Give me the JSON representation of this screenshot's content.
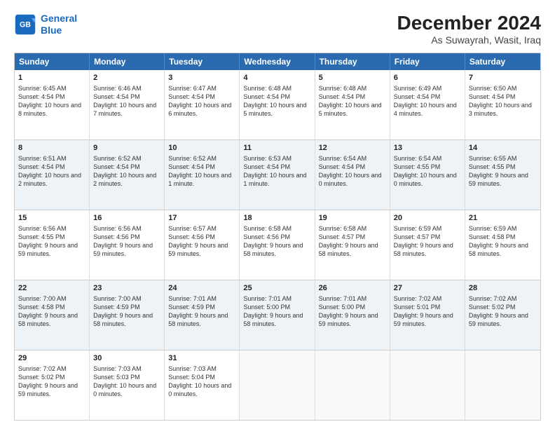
{
  "header": {
    "logo_line1": "General",
    "logo_line2": "Blue",
    "title": "December 2024",
    "subtitle": "As Suwayrah, Wasit, Iraq"
  },
  "calendar": {
    "days": [
      "Sunday",
      "Monday",
      "Tuesday",
      "Wednesday",
      "Thursday",
      "Friday",
      "Saturday"
    ],
    "rows": [
      [
        {
          "day": "1",
          "sunrise": "Sunrise: 6:45 AM",
          "sunset": "Sunset: 4:54 PM",
          "daylight": "Daylight: 10 hours and 8 minutes."
        },
        {
          "day": "2",
          "sunrise": "Sunrise: 6:46 AM",
          "sunset": "Sunset: 4:54 PM",
          "daylight": "Daylight: 10 hours and 7 minutes."
        },
        {
          "day": "3",
          "sunrise": "Sunrise: 6:47 AM",
          "sunset": "Sunset: 4:54 PM",
          "daylight": "Daylight: 10 hours and 6 minutes."
        },
        {
          "day": "4",
          "sunrise": "Sunrise: 6:48 AM",
          "sunset": "Sunset: 4:54 PM",
          "daylight": "Daylight: 10 hours and 5 minutes."
        },
        {
          "day": "5",
          "sunrise": "Sunrise: 6:48 AM",
          "sunset": "Sunset: 4:54 PM",
          "daylight": "Daylight: 10 hours and 5 minutes."
        },
        {
          "day": "6",
          "sunrise": "Sunrise: 6:49 AM",
          "sunset": "Sunset: 4:54 PM",
          "daylight": "Daylight: 10 hours and 4 minutes."
        },
        {
          "day": "7",
          "sunrise": "Sunrise: 6:50 AM",
          "sunset": "Sunset: 4:54 PM",
          "daylight": "Daylight: 10 hours and 3 minutes."
        }
      ],
      [
        {
          "day": "8",
          "sunrise": "Sunrise: 6:51 AM",
          "sunset": "Sunset: 4:54 PM",
          "daylight": "Daylight: 10 hours and 2 minutes."
        },
        {
          "day": "9",
          "sunrise": "Sunrise: 6:52 AM",
          "sunset": "Sunset: 4:54 PM",
          "daylight": "Daylight: 10 hours and 2 minutes."
        },
        {
          "day": "10",
          "sunrise": "Sunrise: 6:52 AM",
          "sunset": "Sunset: 4:54 PM",
          "daylight": "Daylight: 10 hours and 1 minute."
        },
        {
          "day": "11",
          "sunrise": "Sunrise: 6:53 AM",
          "sunset": "Sunset: 4:54 PM",
          "daylight": "Daylight: 10 hours and 1 minute."
        },
        {
          "day": "12",
          "sunrise": "Sunrise: 6:54 AM",
          "sunset": "Sunset: 4:54 PM",
          "daylight": "Daylight: 10 hours and 0 minutes."
        },
        {
          "day": "13",
          "sunrise": "Sunrise: 6:54 AM",
          "sunset": "Sunset: 4:55 PM",
          "daylight": "Daylight: 10 hours and 0 minutes."
        },
        {
          "day": "14",
          "sunrise": "Sunrise: 6:55 AM",
          "sunset": "Sunset: 4:55 PM",
          "daylight": "Daylight: 9 hours and 59 minutes."
        }
      ],
      [
        {
          "day": "15",
          "sunrise": "Sunrise: 6:56 AM",
          "sunset": "Sunset: 4:55 PM",
          "daylight": "Daylight: 9 hours and 59 minutes."
        },
        {
          "day": "16",
          "sunrise": "Sunrise: 6:56 AM",
          "sunset": "Sunset: 4:56 PM",
          "daylight": "Daylight: 9 hours and 59 minutes."
        },
        {
          "day": "17",
          "sunrise": "Sunrise: 6:57 AM",
          "sunset": "Sunset: 4:56 PM",
          "daylight": "Daylight: 9 hours and 59 minutes."
        },
        {
          "day": "18",
          "sunrise": "Sunrise: 6:58 AM",
          "sunset": "Sunset: 4:56 PM",
          "daylight": "Daylight: 9 hours and 58 minutes."
        },
        {
          "day": "19",
          "sunrise": "Sunrise: 6:58 AM",
          "sunset": "Sunset: 4:57 PM",
          "daylight": "Daylight: 9 hours and 58 minutes."
        },
        {
          "day": "20",
          "sunrise": "Sunrise: 6:59 AM",
          "sunset": "Sunset: 4:57 PM",
          "daylight": "Daylight: 9 hours and 58 minutes."
        },
        {
          "day": "21",
          "sunrise": "Sunrise: 6:59 AM",
          "sunset": "Sunset: 4:58 PM",
          "daylight": "Daylight: 9 hours and 58 minutes."
        }
      ],
      [
        {
          "day": "22",
          "sunrise": "Sunrise: 7:00 AM",
          "sunset": "Sunset: 4:58 PM",
          "daylight": "Daylight: 9 hours and 58 minutes."
        },
        {
          "day": "23",
          "sunrise": "Sunrise: 7:00 AM",
          "sunset": "Sunset: 4:59 PM",
          "daylight": "Daylight: 9 hours and 58 minutes."
        },
        {
          "day": "24",
          "sunrise": "Sunrise: 7:01 AM",
          "sunset": "Sunset: 4:59 PM",
          "daylight": "Daylight: 9 hours and 58 minutes."
        },
        {
          "day": "25",
          "sunrise": "Sunrise: 7:01 AM",
          "sunset": "Sunset: 5:00 PM",
          "daylight": "Daylight: 9 hours and 58 minutes."
        },
        {
          "day": "26",
          "sunrise": "Sunrise: 7:01 AM",
          "sunset": "Sunset: 5:00 PM",
          "daylight": "Daylight: 9 hours and 59 minutes."
        },
        {
          "day": "27",
          "sunrise": "Sunrise: 7:02 AM",
          "sunset": "Sunset: 5:01 PM",
          "daylight": "Daylight: 9 hours and 59 minutes."
        },
        {
          "day": "28",
          "sunrise": "Sunrise: 7:02 AM",
          "sunset": "Sunset: 5:02 PM",
          "daylight": "Daylight: 9 hours and 59 minutes."
        }
      ],
      [
        {
          "day": "29",
          "sunrise": "Sunrise: 7:02 AM",
          "sunset": "Sunset: 5:02 PM",
          "daylight": "Daylight: 9 hours and 59 minutes."
        },
        {
          "day": "30",
          "sunrise": "Sunrise: 7:03 AM",
          "sunset": "Sunset: 5:03 PM",
          "daylight": "Daylight: 10 hours and 0 minutes."
        },
        {
          "day": "31",
          "sunrise": "Sunrise: 7:03 AM",
          "sunset": "Sunset: 5:04 PM",
          "daylight": "Daylight: 10 hours and 0 minutes."
        },
        null,
        null,
        null,
        null
      ]
    ]
  }
}
